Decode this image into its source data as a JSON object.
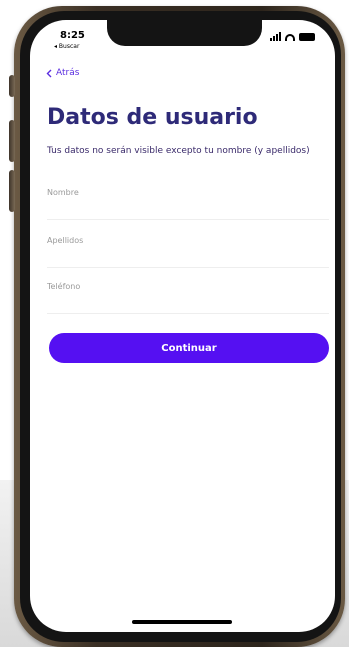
{
  "status_bar": {
    "time": "8:25",
    "carrier": "◂ Buscar"
  },
  "nav": {
    "back_label": "Atrás"
  },
  "page": {
    "title": "Datos de usuario",
    "description": "Tus datos no serán visible excepto tu nombre (y apellidos)"
  },
  "form": {
    "fields": [
      {
        "label": "Nombre",
        "value": ""
      },
      {
        "label": "Apellidos",
        "value": ""
      },
      {
        "label": "Teléfono",
        "value": ""
      }
    ],
    "submit_label": "Continuar"
  },
  "colors": {
    "accent": "#5510F2",
    "title": "#2E2A78",
    "frame": "#3A2F24"
  }
}
